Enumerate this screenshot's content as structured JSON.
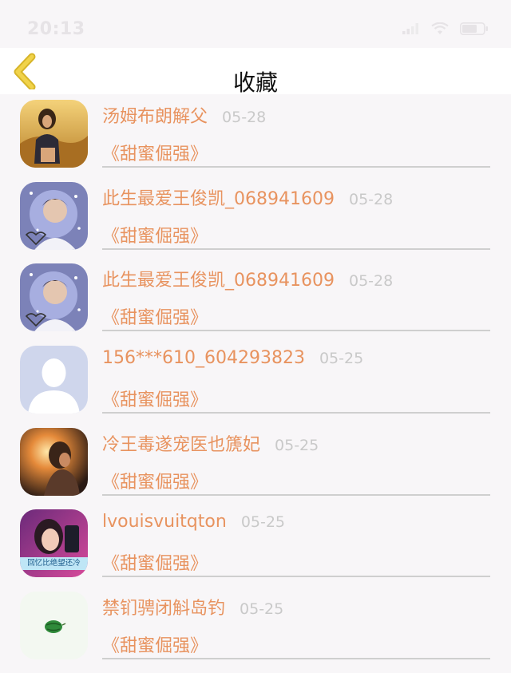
{
  "status_bar": {
    "time": "20:13"
  },
  "nav": {
    "title": "收藏",
    "back_icon": "chevron-left-icon"
  },
  "colors": {
    "accent": "#e8935f",
    "back_chevron": "#e2c22a",
    "date": "#c9c9c9"
  },
  "favorites": [
    {
      "name": "汤姆布朗解父",
      "date": "05-28",
      "song": "《甜蜜倔强》",
      "avatar": "girl-in-field-avatar"
    },
    {
      "name": "此生最爱王俊凯_068941609",
      "date": "05-28",
      "song": "《甜蜜倔强》",
      "avatar": "sparkle-portrait-avatar"
    },
    {
      "name": "此生最爱王俊凯_068941609",
      "date": "05-28",
      "song": "《甜蜜倔强》",
      "avatar": "sparkle-portrait-avatar"
    },
    {
      "name": "156***610_604293823",
      "date": "05-25",
      "song": "《甜蜜倔强》",
      "avatar": "default-user-avatar"
    },
    {
      "name": "冷王毒遂宠医也篪妃",
      "date": "05-25",
      "song": "《甜蜜倔强》",
      "avatar": "sunset-girl-avatar"
    },
    {
      "name": "lvouisvuitqton",
      "date": "05-25",
      "song": "《甜蜜倔强》",
      "avatar": "girl-with-caption-avatar",
      "avatar_caption": "回忆比绝望还冷"
    },
    {
      "name": "禁钔骋闭斛岛钓",
      "date": "05-25",
      "song": "《甜蜜倔强》",
      "avatar": "watermelon-avatar"
    }
  ]
}
